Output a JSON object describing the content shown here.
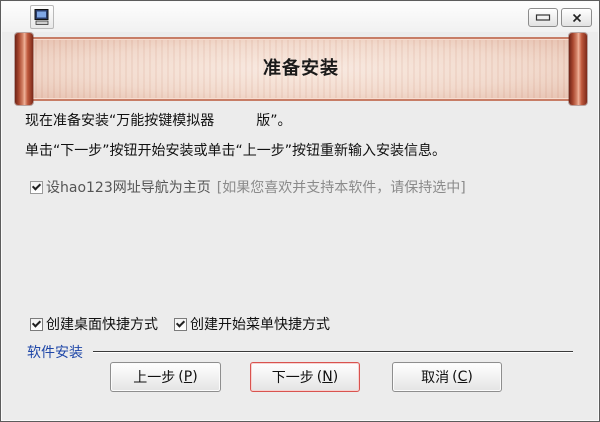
{
  "icons": {
    "app": "installer-app-icon",
    "minimize": "minimize-icon",
    "close": "close-icon",
    "checkbox_mark": "checkmark-icon"
  },
  "colors": {
    "window_bg": "#ECECEC",
    "accent": "#1F47A8",
    "default_button_border": "#D9534F",
    "hint_text": "#8A8A8A",
    "banner_paper": "#F1D8CA",
    "banner_roll": "#A9472F"
  },
  "banner": {
    "title": "准备安装"
  },
  "content": {
    "intro_line": "现在准备安装“万能按键模拟器　　　版”。",
    "instruction_line": "单击“下一步”按钮开始安装或单击“上一步”按钮重新输入安装信息。",
    "homepage_option": {
      "label": "设hao123网址导航为主页",
      "hint": "[如果您喜欢并支持本软件，请保持选中]",
      "checked": true
    }
  },
  "shortcuts": {
    "desktop": {
      "label": "创建桌面快捷方式",
      "checked": true
    },
    "start_menu": {
      "label": "创建开始菜单快捷方式",
      "checked": true
    }
  },
  "footer": {
    "group_label": "软件安装",
    "buttons": {
      "back": {
        "label": "上一步",
        "paren_open": "(",
        "accel_key": "P",
        "paren_close": ")"
      },
      "next": {
        "label": "下一步",
        "paren_open": "(",
        "accel_key": "N",
        "paren_close": ")",
        "is_default": true
      },
      "cancel": {
        "label": "取消",
        "paren_open": "(",
        "accel_key": "C",
        "paren_close": ")"
      }
    }
  }
}
